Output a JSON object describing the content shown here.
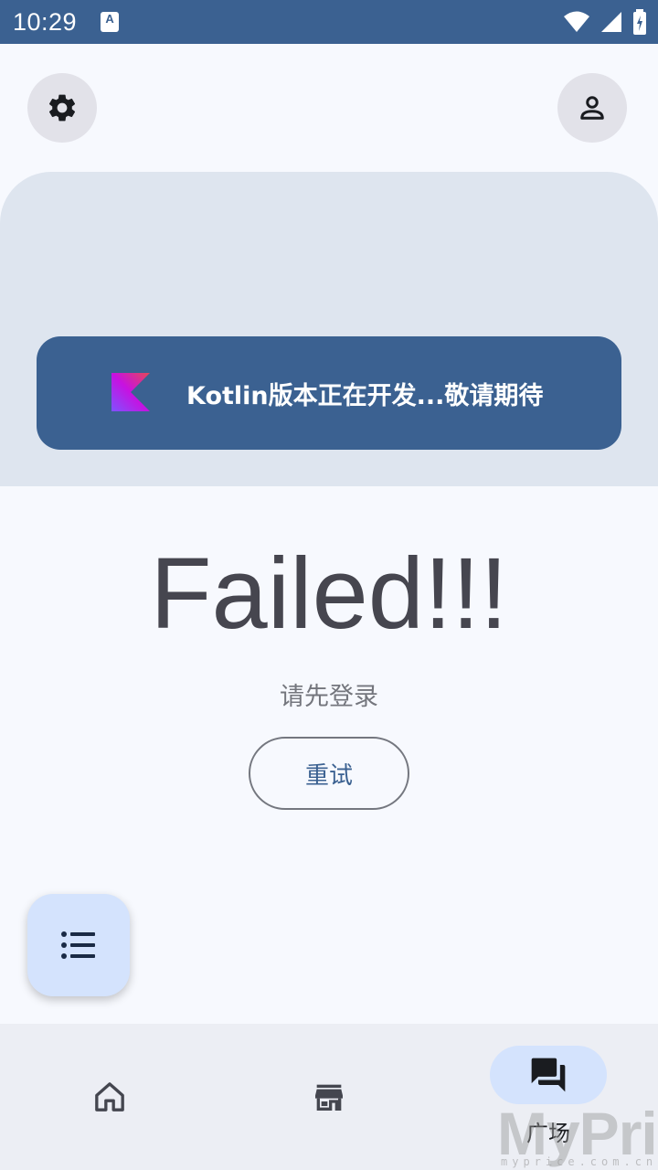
{
  "status_bar": {
    "time": "10:29",
    "notification_icon_label": "A"
  },
  "header": {
    "settings_icon": "gear-icon",
    "account_icon": "person-icon"
  },
  "banner": {
    "logo": "kotlin-logo",
    "text": "Kotlin版本正在开发...敬请期待"
  },
  "main": {
    "title": "Failed!!!",
    "hint": "请先登录",
    "retry_label": "重试"
  },
  "fab": {
    "icon": "list-icon"
  },
  "bottom_nav": {
    "items": [
      {
        "icon": "home-icon",
        "label": "",
        "active": false
      },
      {
        "icon": "store-icon",
        "label": "",
        "active": false
      },
      {
        "icon": "forum-icon",
        "label": "广场",
        "active": true
      }
    ]
  },
  "watermark": {
    "text": "MyPrice",
    "subtext": "myprice.com.cn"
  },
  "colors": {
    "primary": "#3b6191",
    "background": "#f7f9fe",
    "panel": "#dee5ef",
    "nav_active": "#d4e3fd"
  }
}
